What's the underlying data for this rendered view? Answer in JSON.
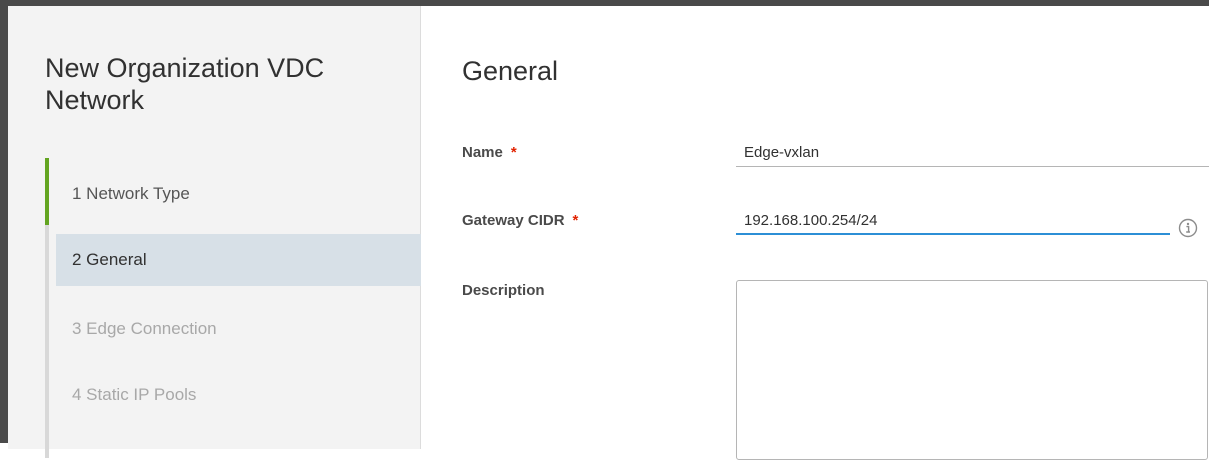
{
  "wizard": {
    "title": "New Organization VDC Network",
    "steps": [
      {
        "label": "1 Network Type",
        "state": "completed"
      },
      {
        "label": "2 General",
        "state": "active"
      },
      {
        "label": "3 Edge Connection",
        "state": "disabled"
      },
      {
        "label": "4 Static IP Pools",
        "state": "disabled"
      }
    ]
  },
  "form": {
    "section_title": "General",
    "name": {
      "label": "Name",
      "required": "*",
      "value": "Edge-vxlan"
    },
    "gateway_cidr": {
      "label": "Gateway CIDR",
      "required": "*",
      "value": "192.168.100.254/24",
      "help_icon": "info-icon"
    },
    "description": {
      "label": "Description",
      "value": ""
    }
  },
  "colors": {
    "progress": "#62a420",
    "active_step_bg": "#d7e0e7",
    "focus_underline": "#2c8fd6",
    "required": "#e12200"
  }
}
